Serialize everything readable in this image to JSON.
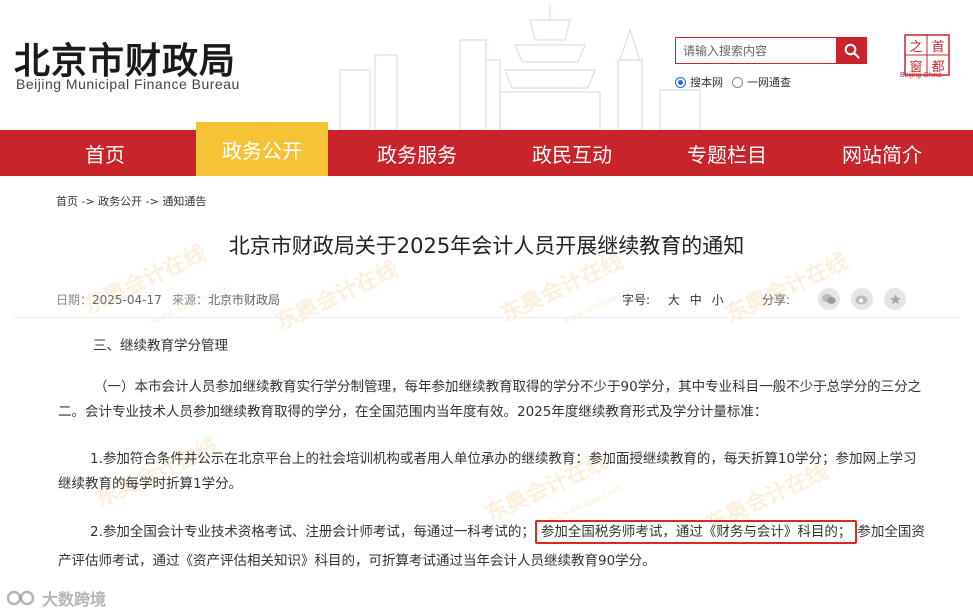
{
  "header": {
    "title": "北京市财政局",
    "subtitle": "Beijing Municipal Finance Bureau",
    "search_placeholder": "请输入搜索内容",
    "scope_site": "搜本网",
    "scope_all": "一网通查",
    "seal_caption": "Beijing·China",
    "seal_chars": [
      "首",
      "都",
      "之",
      "窗"
    ]
  },
  "nav": {
    "items": [
      {
        "label": "首页",
        "active": false
      },
      {
        "label": "政务公开",
        "active": true
      },
      {
        "label": "政务服务",
        "active": false
      },
      {
        "label": "政民互动",
        "active": false
      },
      {
        "label": "专题栏目",
        "active": false
      },
      {
        "label": "网站简介",
        "active": false
      }
    ]
  },
  "breadcrumb": "首页 -> 政务公开 -> 通知通告",
  "article": {
    "title": "北京市财政局关于2025年会计人员开展继续教育的通知",
    "date_label": "日期：",
    "date": "2025-04-17",
    "source_label": "来源：",
    "source": "北京市财政局",
    "font_label": "字号:",
    "font_sizes": [
      "大",
      "中",
      "小"
    ],
    "share_label": "分享:",
    "section_head": "三、继续教育学分管理",
    "para1": "（一）本市会计人员参加继续教育实行学分制管理，每年参加继续教育取得的学分不少于90学分，其中专业科目一般不少于总学分的三分之二。会计专业技术人员参加继续教育取得的学分，在全国范围内当年度有效。2025年度继续教育形式及学分计量标准：",
    "para2": "1.参加符合条件并公示在北京平台上的社会培训机构或者用人单位承办的继续教育：参加面授继续教育的，每天折算10学分；参加网上学习继续教育的每学时折算1学分。",
    "para3_a": "2.参加全国会计专业技术资格考试、注册会计师考试，每通过一科考试的；",
    "para3_highlight": "参加全国税务师考试，通过《财务与会计》科目的；",
    "para3_b": "参加全国资产评估师考试，通过《资产评估相关知识》科目的，可折算考试通过当年会计人员继续教育90学分。"
  },
  "watermark": {
    "text": "东奥会计在线",
    "url": "www.dongao.com"
  },
  "corner_logo": "大数跨境",
  "colors": {
    "brand_red": "#c9242b",
    "nav_active": "#f6c236",
    "highlight_border": "#e0271f"
  }
}
